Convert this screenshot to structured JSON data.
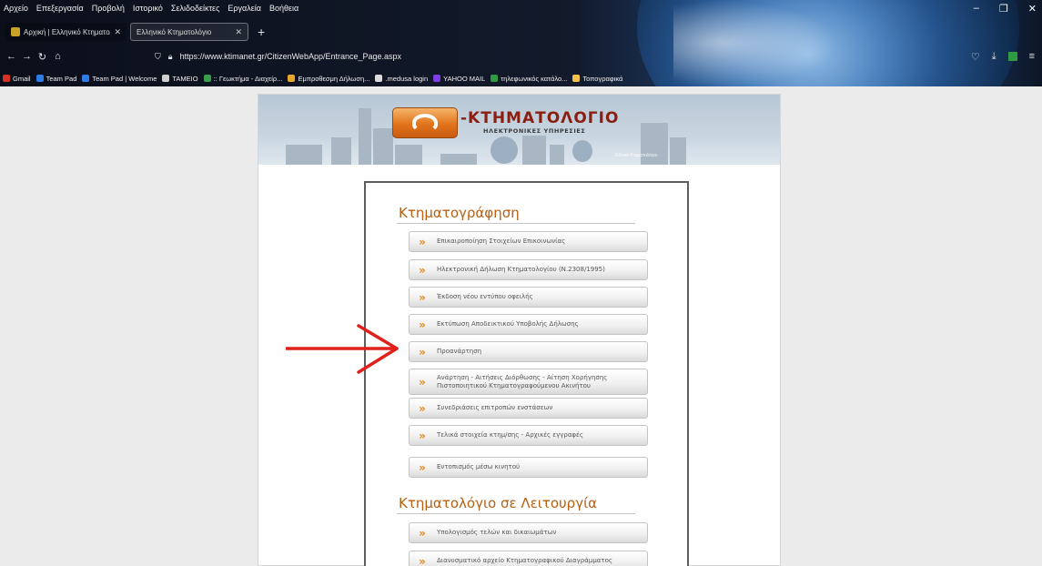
{
  "browser": {
    "menu": [
      "Αρχείο",
      "Επεξεργασία",
      "Προβολή",
      "Ιστορικό",
      "Σελιδοδείκτες",
      "Εργαλεία",
      "Βοήθεια"
    ],
    "tabs": [
      {
        "label": "Αρχική | Ελληνικό Κτηματολόγι",
        "active": false
      },
      {
        "label": "Ελληνικό Κτηματολόγιο",
        "active": true
      }
    ],
    "new_tab": "+",
    "url": "https://www.ktimanet.gr/CitizenWebApp/Entrance_Page.aspx",
    "bookmarks": [
      {
        "label": "Gmail",
        "color": "#d93025"
      },
      {
        "label": "Team Pad",
        "color": "#2d7be5"
      },
      {
        "label": "Team Pad | Welcome",
        "color": "#2d7be5"
      },
      {
        "label": "TAMEIO",
        "color": "#cfcfcf"
      },
      {
        "label": ":: Γεωκτήμα - Διαχείρ...",
        "color": "#3b9c4a"
      },
      {
        "label": "Εμπροθεσμη Δήλωση...",
        "color": "#e7a52c"
      },
      {
        "label": ".medusa login",
        "color": "#dcdcdc"
      },
      {
        "label": "YAHOO MAIL",
        "color": "#7b3fe4"
      },
      {
        "label": "τηλεφωνικός κατάλο...",
        "color": "#2e9b41"
      },
      {
        "label": "Τοπογραφικά",
        "color": "#f3c24a"
      }
    ]
  },
  "site": {
    "logo_title": "-ΚΤΗΜΑΤΟΛΟΓΙΟ",
    "logo_subtitle": "ΗΛΕΚΤΡΟΝΙΚΕΣ ΥΠΗΡΕΣΙΕΣ",
    "banner_signature": "Εθνικό Κτηματολόγιο"
  },
  "sections": [
    {
      "title": "Κτηματογράφηση",
      "items": [
        "Επικαιροποίηση Στοιχείων Επικοινωνίας",
        "Ηλεκτρονική Δήλωση Κτηματολογίου (Ν.2308/1995)",
        "Έκδοση νέου εντύπου οφειλής",
        "Εκτύπωση Αποδεικτικού Υποβολής Δήλωσης",
        "Προανάρτηση",
        "Ανάρτηση - Αιτήσεις Διόρθωσης - Αίτηση Χορήγησης Πιστοποιητικού Κτηματογραφούμενου Ακινήτου",
        "Συνεδριάσεις επιτροπών ενστάσεων",
        "Τελικά στοιχεία κτημ/σης - Αρχικές εγγραφές",
        "Εντοπισμός μέσω κινητού"
      ]
    },
    {
      "title": "Κτηματολόγιο σε Λειτουργία",
      "items": [
        "Υπολογισμός τελών και δικαιωμάτων",
        "Διανυσματικό αρχείο Κτηματογραφικού Διαγράμματος"
      ]
    }
  ],
  "colors": {
    "accent_orange": "#e58a1a",
    "section_title": "#b65f12",
    "annotation_arrow": "#e0201a"
  }
}
